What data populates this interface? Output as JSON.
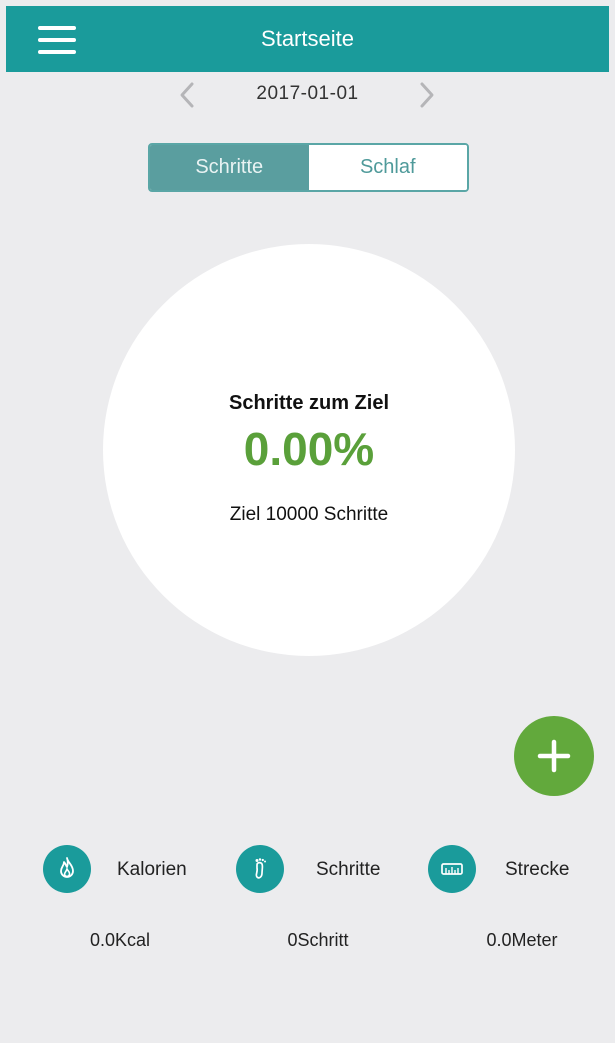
{
  "header": {
    "title": "Startseite",
    "menu_icon": "hamburger-menu-icon",
    "color": "#1a9b9b"
  },
  "date_nav": {
    "date": "2017-01-01",
    "prev_icon": "chevron-left-icon",
    "next_icon": "chevron-right-icon"
  },
  "tabs": [
    {
      "label": "Schritte",
      "active": true
    },
    {
      "label": "Schlaf",
      "active": false
    }
  ],
  "progress": {
    "label": "Schritte zum Ziel",
    "percent": "0.00%",
    "goal": "Ziel 10000 Schritte",
    "accent": "#5aa03a"
  },
  "fab": {
    "icon": "plus-icon",
    "color": "#62a93c"
  },
  "stats": [
    {
      "icon": "flame-icon",
      "label": "Kalorien",
      "value": "0.0Kcal"
    },
    {
      "icon": "footprint-icon",
      "label": "Schritte",
      "value": "0Schritt"
    },
    {
      "icon": "ruler-icon",
      "label": "Strecke",
      "value": "0.0Meter"
    }
  ]
}
